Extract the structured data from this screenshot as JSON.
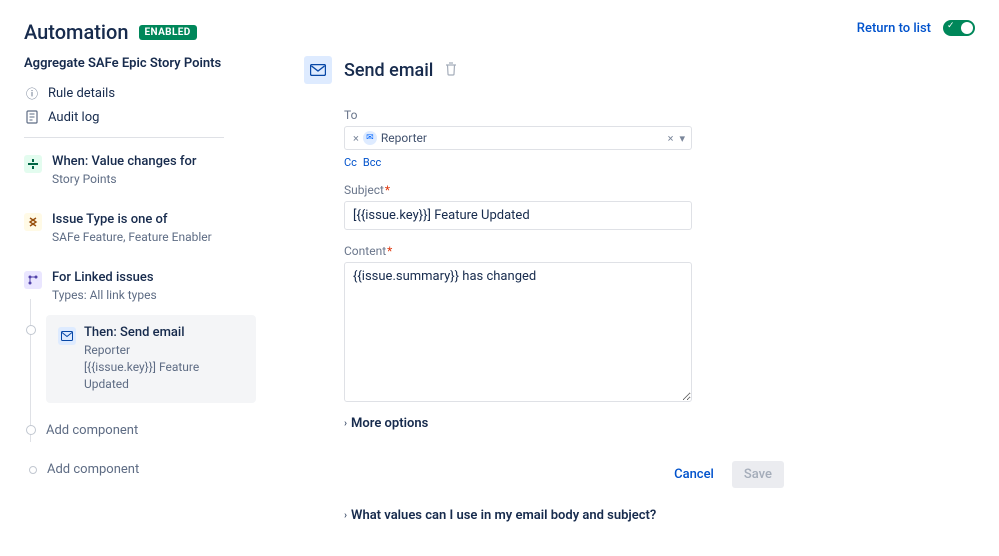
{
  "sidebar": {
    "title": "Automation",
    "enabled_badge": "ENABLED",
    "rule_name": "Aggregate SAFe Epic Story Points",
    "meta": {
      "rule_details": "Rule details",
      "audit_log": "Audit log"
    },
    "steps": {
      "trigger": {
        "title": "When: Value changes for",
        "desc": "Story Points"
      },
      "condition": {
        "title": "Issue Type is one of",
        "desc": "SAFe Feature, Feature Enabler"
      },
      "branch": {
        "title": "For Linked issues",
        "desc": "Types: All link types"
      },
      "action": {
        "title": "Then: Send email",
        "line1": "Reporter",
        "line2": "[{{issue.key}}] Feature Updated"
      }
    },
    "add_component": "Add component"
  },
  "top": {
    "return": "Return to list"
  },
  "panel": {
    "title": "Send email",
    "to_label": "To",
    "recipient": "Reporter",
    "cc": "Cc",
    "bcc": "Bcc",
    "subject_label": "Subject",
    "subject_value": "[{{issue.key}}] Feature Updated",
    "content_label": "Content",
    "content_value": "{{issue.summary}} has changed",
    "more_options": "More options",
    "smart_values": "What values can I use in my email body and subject?",
    "cancel": "Cancel",
    "save": "Save"
  }
}
